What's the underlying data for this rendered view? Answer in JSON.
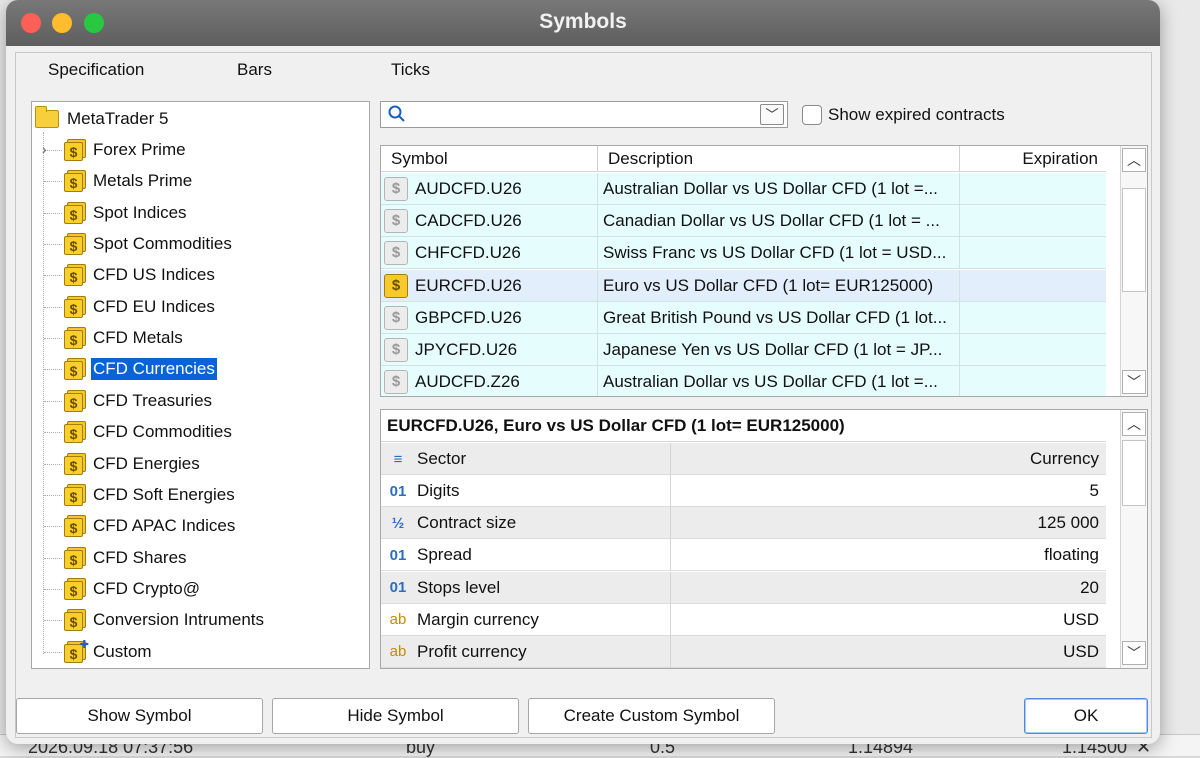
{
  "window": {
    "title": "Symbols"
  },
  "tabs": [
    "Specification",
    "Bars",
    "Ticks"
  ],
  "tree": {
    "root": "MetaTrader 5",
    "items": [
      {
        "label": "Forex Prime",
        "expandable": true
      },
      {
        "label": "Metals Prime"
      },
      {
        "label": "Spot Indices"
      },
      {
        "label": "Spot Commodities"
      },
      {
        "label": "CFD US Indices"
      },
      {
        "label": "CFD EU Indices"
      },
      {
        "label": "CFD Metals"
      },
      {
        "label": "CFD Currencies",
        "selected": true
      },
      {
        "label": "CFD Treasuries"
      },
      {
        "label": "CFD Commodities"
      },
      {
        "label": "CFD Energies"
      },
      {
        "label": "CFD Soft Energies"
      },
      {
        "label": "CFD APAC Indices"
      },
      {
        "label": "CFD Shares"
      },
      {
        "label": "CFD Crypto@"
      },
      {
        "label": "Conversion Intruments"
      },
      {
        "label": "Custom"
      }
    ]
  },
  "search": {
    "value": "",
    "placeholder": ""
  },
  "show_expired_label": "Show expired contracts",
  "symbols": {
    "columns": [
      "Symbol",
      "Description",
      "Expiration"
    ],
    "rows": [
      {
        "symbol": "AUDCFD.U26",
        "description": "Australian Dollar vs US Dollar CFD  (1 lot =...",
        "expiration": ""
      },
      {
        "symbol": "CADCFD.U26",
        "description": "Canadian Dollar vs US Dollar CFD  (1 lot = ...",
        "expiration": ""
      },
      {
        "symbol": "CHFCFD.U26",
        "description": "Swiss Franc vs US Dollar CFD  (1 lot = USD...",
        "expiration": ""
      },
      {
        "symbol": "EURCFD.U26",
        "description": "Euro vs US Dollar CFD (1 lot= EUR125000)",
        "expiration": "",
        "active": true
      },
      {
        "symbol": "GBPCFD.U26",
        "description": "Great British Pound vs US Dollar CFD (1 lot...",
        "expiration": ""
      },
      {
        "symbol": "JPYCFD.U26",
        "description": "Japanese Yen vs US Dollar CFD  (1 lot = JP...",
        "expiration": ""
      },
      {
        "symbol": "AUDCFD.Z26",
        "description": "Australian Dollar vs US Dollar CFD  (1 lot =...",
        "expiration": ""
      }
    ]
  },
  "details": {
    "title": "EURCFD.U26, Euro vs US Dollar CFD (1 lot= EUR125000)",
    "properties": [
      {
        "icon": "sector-icon",
        "glyph": "≡",
        "name": "Sector",
        "value": "Currency"
      },
      {
        "icon": "number-icon",
        "glyph": "01",
        "name": "Digits",
        "value": "5"
      },
      {
        "icon": "fraction-icon",
        "glyph": "½",
        "name": "Contract size",
        "value": "125 000"
      },
      {
        "icon": "number-icon",
        "glyph": "01",
        "name": "Spread",
        "value": "floating"
      },
      {
        "icon": "number-icon",
        "glyph": "01",
        "name": "Stops level",
        "value": "20"
      },
      {
        "icon": "text-icon",
        "glyph": "ab",
        "name": "Margin currency",
        "value": "USD"
      },
      {
        "icon": "text-icon",
        "glyph": "ab",
        "name": "Profit currency",
        "value": "USD"
      }
    ]
  },
  "buttons": {
    "show_symbol": "Show Symbol",
    "hide_symbol": "Hide Symbol",
    "create_custom": "Create Custom Symbol",
    "ok": "OK"
  },
  "background_row": {
    "time": "2026.09.18 07:37:56",
    "type": "buy",
    "volume": "0.5",
    "price_open": "1.14894",
    "price_close": "1.14500"
  },
  "colors": {
    "selection": "#0a63d6",
    "row_tint": "#e6fdfd",
    "symbol_gold": "#f8c92b"
  }
}
